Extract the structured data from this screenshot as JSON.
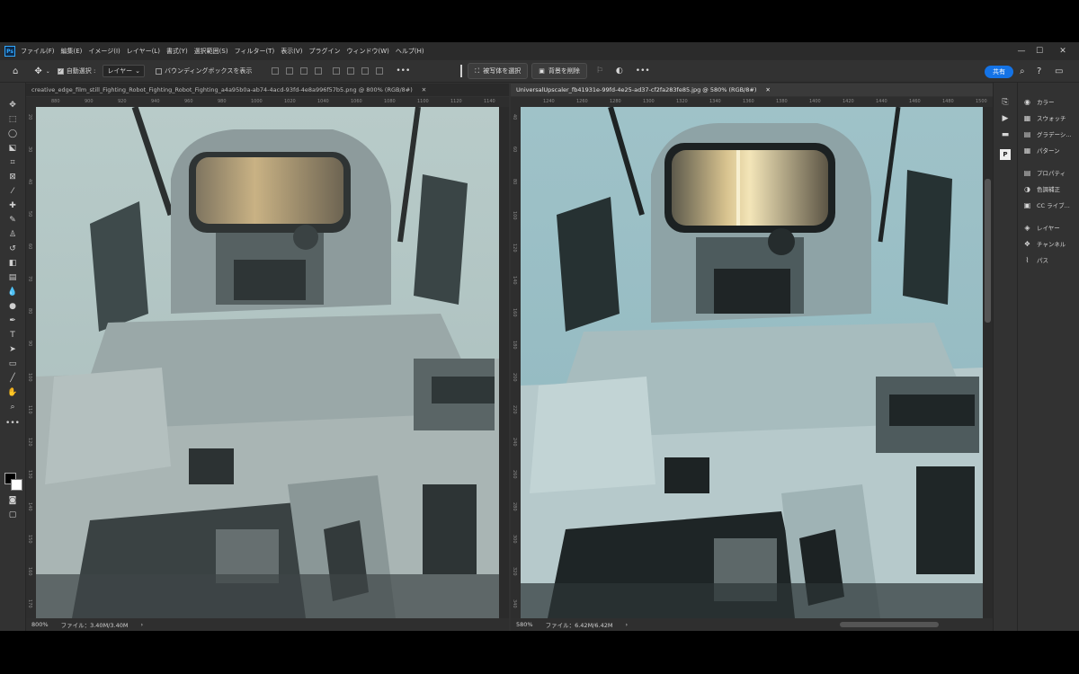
{
  "app": {
    "logo": "Ps"
  },
  "menu": [
    "ファイル(F)",
    "編集(E)",
    "イメージ(I)",
    "レイヤー(L)",
    "書式(Y)",
    "選択範囲(S)",
    "フィルター(T)",
    "表示(V)",
    "プラグイン",
    "ウィンドウ(W)",
    "ヘルプ(H)"
  ],
  "options": {
    "auto_select_label": "自動選択 :",
    "layer_select": "レイヤー",
    "bbox_label": "バウンディングボックスを表示",
    "select_subject": "被写体を選択",
    "remove_bg": "背景を削除",
    "more": "•••"
  },
  "share_label": "共有",
  "docs": {
    "left": {
      "title": "creative_edge_film_still_Fighting_Robot_Fighting_Robot_Fighting_a4a95b0a-ab74-4acd-93fd-4e8a996f57b5.png @ 800% (RGB/8#)",
      "zoom": "800%",
      "file_info": "ファイル：3.40M/3.40M",
      "ruler_top": [
        "880",
        "900",
        "920",
        "940",
        "960",
        "980",
        "1000",
        "1020",
        "1040",
        "1060",
        "1080",
        "1100",
        "1120",
        "1140"
      ],
      "ruler_left": [
        "20",
        "30",
        "40",
        "50",
        "60",
        "70",
        "80",
        "90",
        "100",
        "110",
        "120",
        "130",
        "140",
        "150",
        "160",
        "170"
      ]
    },
    "right": {
      "title": "UniversalUpscaler_fb41931e-99fd-4e25-ad37-cf2fa283fe85.jpg @ 580% (RGB/8#)",
      "zoom": "580%",
      "file_info": "ファイル：6.42M/6.42M",
      "ruler_top": [
        "1240",
        "1260",
        "1280",
        "1300",
        "1320",
        "1340",
        "1360",
        "1380",
        "1400",
        "1420",
        "1440",
        "1460",
        "1480",
        "1500"
      ],
      "ruler_left": [
        "40",
        "60",
        "80",
        "100",
        "120",
        "140",
        "160",
        "180",
        "200",
        "220",
        "240",
        "260",
        "280",
        "300",
        "320",
        "340"
      ]
    }
  },
  "panels": [
    {
      "label": "カラー",
      "icon": "color-icon"
    },
    {
      "label": "スウォッチ",
      "icon": "swatches-icon"
    },
    {
      "label": "グラデーシ...",
      "icon": "gradients-icon"
    },
    {
      "label": "パターン",
      "icon": "patterns-icon"
    },
    {
      "label": "プロパティ",
      "icon": "properties-icon"
    },
    {
      "label": "色調補正",
      "icon": "adjustments-icon"
    },
    {
      "label": "CC ライブ...",
      "icon": "cc-libraries-icon"
    },
    {
      "label": "レイヤー",
      "icon": "layers-icon"
    },
    {
      "label": "チャンネル",
      "icon": "channels-icon"
    },
    {
      "label": "パス",
      "icon": "paths-icon"
    }
  ],
  "colors": {
    "accent": "#1473e6",
    "bg": "#323232"
  }
}
